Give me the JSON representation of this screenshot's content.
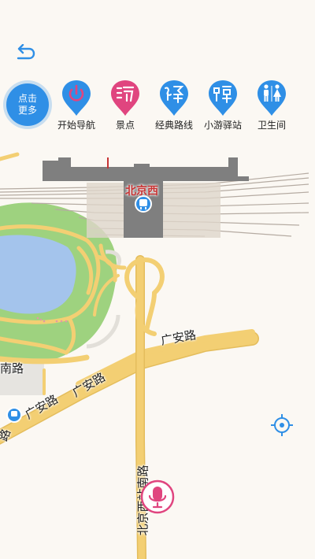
{
  "toolbar": {
    "more_line1": "点击",
    "more_line2": "更多",
    "categories": [
      {
        "label": "开始导航",
        "icon": "power-icon"
      },
      {
        "label": "景点",
        "icon": "attraction-icon"
      },
      {
        "label": "经典路线",
        "icon": "classic-route-icon"
      },
      {
        "label": "小游驿站",
        "icon": "tourist-station-icon"
      },
      {
        "label": "卫生间",
        "icon": "restroom-icon"
      }
    ]
  },
  "map": {
    "station_name": "北京西",
    "roads": {
      "guangan_upper": "广安路",
      "guangan_lower_1": "广安路",
      "guangan_lower_2": "广安路",
      "south_road": "南路",
      "lower_left_fragment": "路",
      "beijingxi_south": "北京西站南路"
    }
  },
  "colors": {
    "accent": "#2f8fe6",
    "attraction_pink": "#e0457f",
    "station_red": "#c73434",
    "road_yellow": "#f3cf73",
    "park_green": "#9ed27f",
    "water_blue": "#a4c4ec",
    "background": "#fbf8f3"
  }
}
